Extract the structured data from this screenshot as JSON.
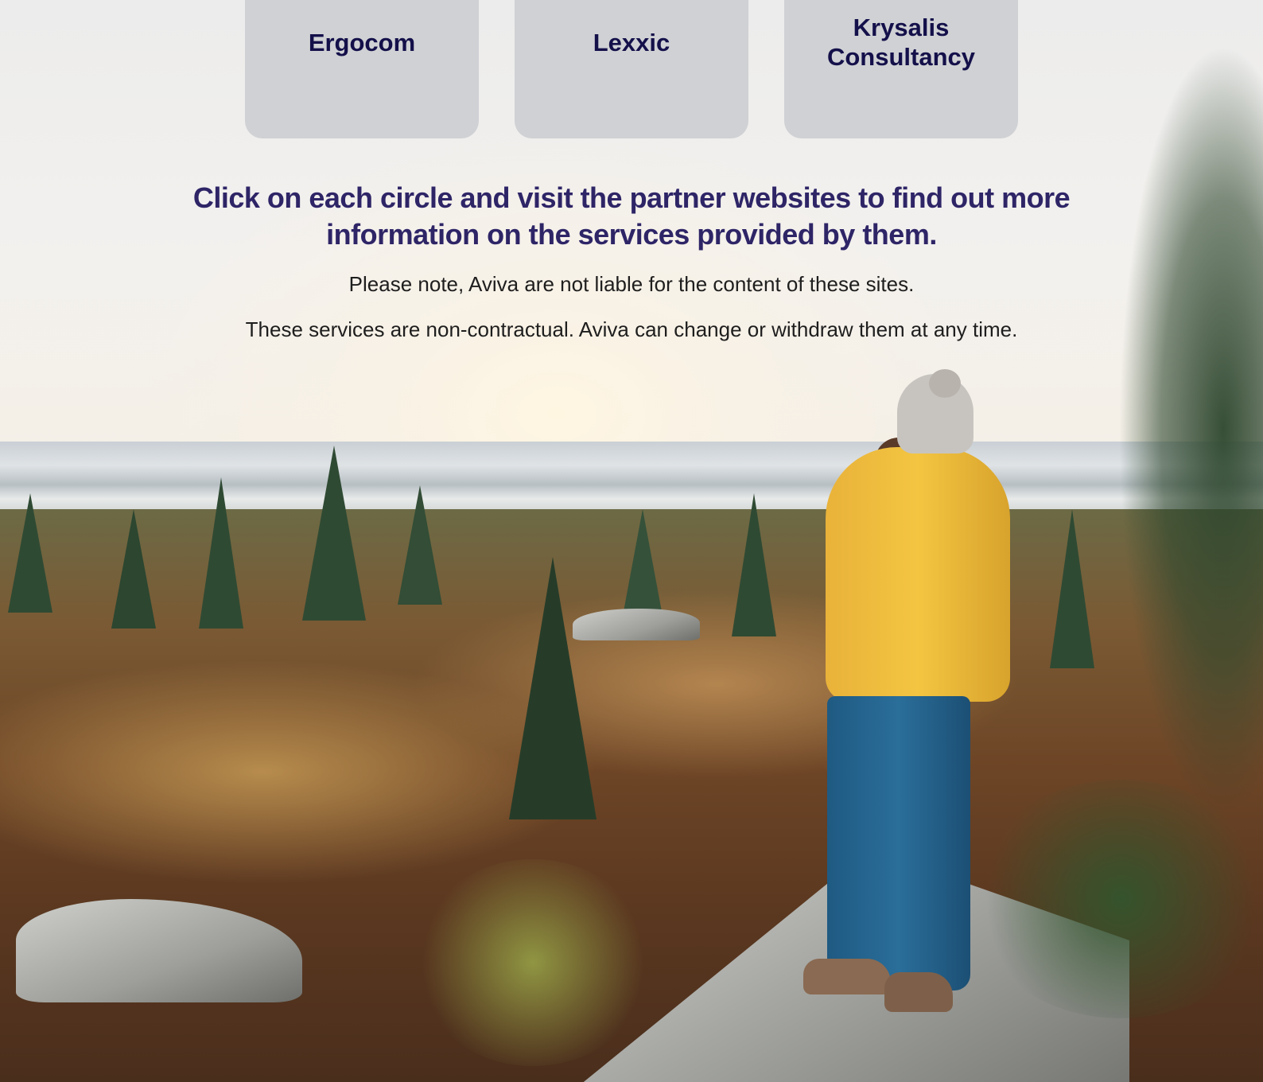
{
  "partners": [
    {
      "name": "Ergocom"
    },
    {
      "name": "Lexxic"
    },
    {
      "name": "Krysalis\nConsultancy"
    }
  ],
  "headline": "Click on each circle and visit the partner websites to find out more information on the services provided by them.",
  "notes": {
    "liability": "Please note, Aviva are not liable for the content of these sites.",
    "non_contractual": "These services are non-contractual. Aviva can change or withdraw them at any time."
  },
  "colors": {
    "headline": "#2e2567",
    "card_text": "#14104a",
    "card_bg": "#cfd1d4",
    "body_text": "#1e1e1e"
  },
  "background": {
    "type": "photo",
    "icon": "hiker-landscape-image"
  }
}
